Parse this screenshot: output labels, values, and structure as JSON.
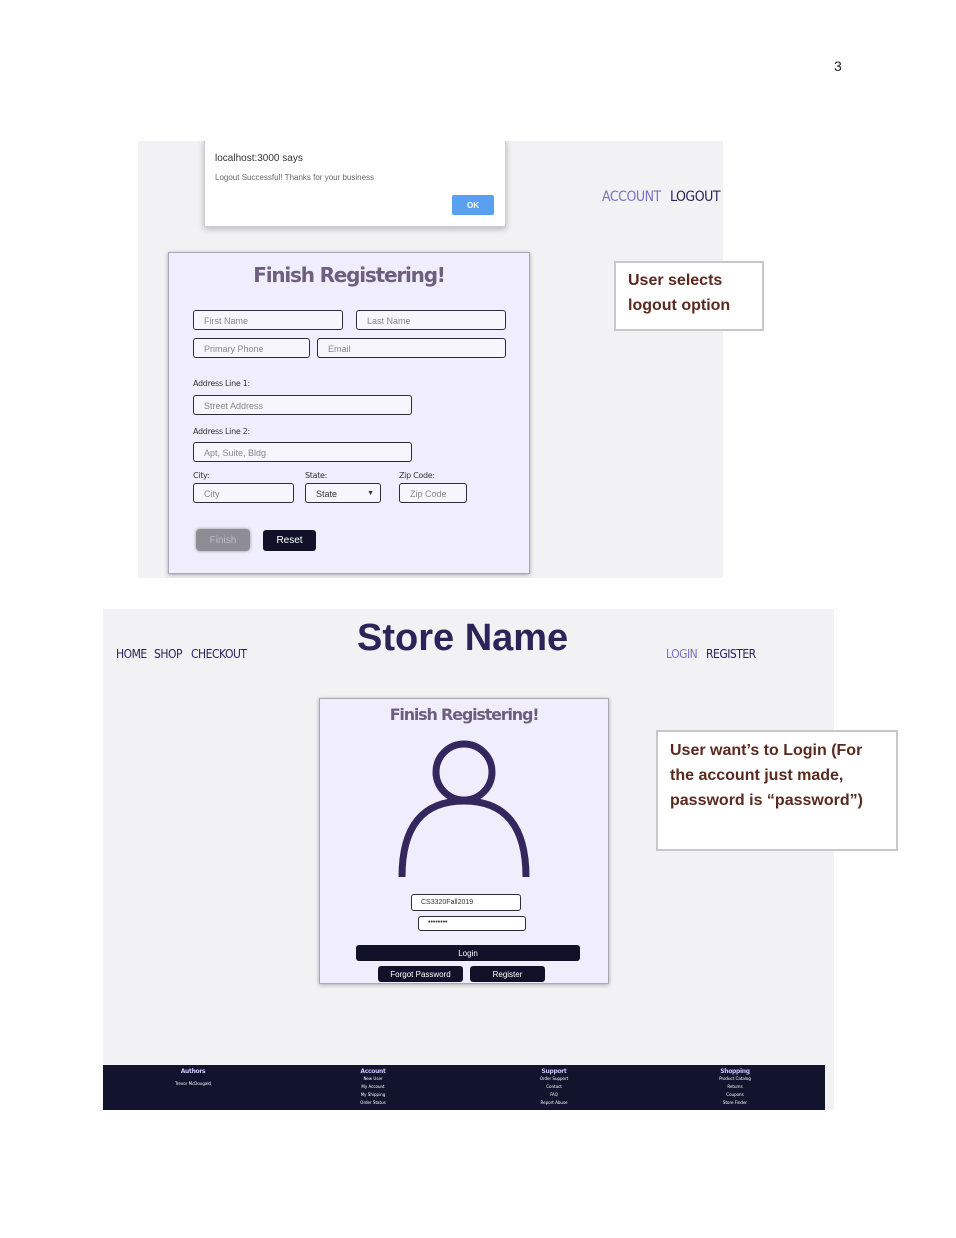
{
  "page_number": "3",
  "screenshot1": {
    "alert": {
      "title": "localhost:3000 says",
      "message": "Logout Successful! Thanks for your business",
      "ok_label": "OK"
    },
    "nav": {
      "account": "ACCOUNT",
      "logout": "LOGOUT"
    },
    "form": {
      "title": "Finish Registering!",
      "first_name_placeholder": "First Name",
      "last_name_placeholder": "Last Name",
      "phone_placeholder": "Primary Phone",
      "email_placeholder": "Email",
      "address1_label": "Address Line 1:",
      "address1_placeholder": "Street Address",
      "address2_label": "Address Line 2:",
      "address2_placeholder": "Apt, Suite, Bldg",
      "city_label": "City:",
      "city_placeholder": "City",
      "state_label": "State:",
      "state_selected": "State",
      "zip_label": "Zip Code:",
      "zip_placeholder": "Zip Code",
      "finish_label": "Finish",
      "reset_label": "Reset"
    }
  },
  "callout1": {
    "line1": "User selects",
    "line2": "logout option"
  },
  "screenshot2": {
    "nav": {
      "home": "HOME",
      "shop": "SHOP",
      "checkout": "CHECKOUT",
      "login": "LOGIN",
      "register": "REGISTER"
    },
    "store_name": "Store Name",
    "login": {
      "title": "Finish Registering!",
      "username_value": "CS3320Fall2019",
      "password_value": "••••••••",
      "login_label": "Login",
      "forgot_label": "Forgot Password",
      "register_label": "Register"
    },
    "footer": {
      "authors": {
        "heading": "Authors",
        "items": [
          "Trevor McDougald"
        ]
      },
      "account": {
        "heading": "Account",
        "items": [
          "New User",
          "My Account",
          "My Shipping",
          "Order Status"
        ]
      },
      "support": {
        "heading": "Support",
        "items": [
          "Order Support",
          "Contact",
          "FAQ",
          "Report Abuse"
        ]
      },
      "shopping": {
        "heading": "Shopping",
        "items": [
          "Product Catalog",
          "Returns",
          "Coupons",
          "Store Finder"
        ]
      }
    }
  },
  "callout2": {
    "line1": "User want’s to Login (For",
    "line2": "the account just made,",
    "line3": "password is “password”)"
  },
  "colors": {
    "dark_navy": "#11122a",
    "accent_purple": "#7b70c4",
    "form_bg": "#f0eefc",
    "callout_text": "#5a2a1e"
  }
}
